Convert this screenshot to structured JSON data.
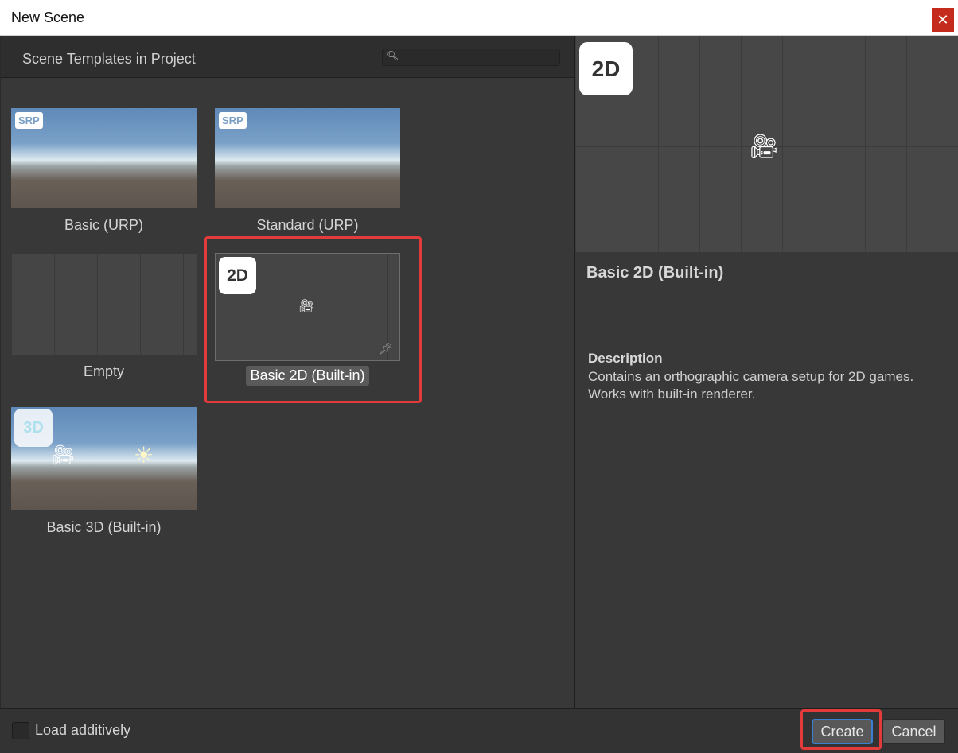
{
  "window": {
    "title": "New Scene",
    "close_glyph": "✕"
  },
  "left_panel": {
    "header": "Scene Templates in Project",
    "search_placeholder": "",
    "templates": [
      {
        "name": "Basic (URP)",
        "badge": "SRP",
        "thumb": "sky"
      },
      {
        "name": "Standard (URP)",
        "badge": "SRP",
        "thumb": "sky"
      },
      {
        "name": "Empty",
        "badge": "",
        "thumb": "dark"
      },
      {
        "name": "Basic 2D (Built-in)",
        "badge": "2D",
        "thumb": "dark",
        "selected": true,
        "pinned": true
      },
      {
        "name": "Basic 3D (Built-in)",
        "badge": "3D",
        "thumb": "sky"
      }
    ],
    "thumbnail_size_slider": 0.3
  },
  "right_panel": {
    "preview_badge": "2D",
    "title": "Basic 2D (Built-in)",
    "description_heading": "Description",
    "description": "Contains an orthographic camera setup for 2D games. Works with built-in renderer."
  },
  "footer": {
    "load_additively_label": "Load additively",
    "load_additively_checked": false,
    "create_label": "Create",
    "cancel_label": "Cancel"
  },
  "colors": {
    "highlight": "#e23b3b",
    "create_border": "#3c7fd2",
    "close_bg": "#c42b1c"
  },
  "icons": {
    "search": "search-icon",
    "camera": "camera-icon",
    "sun": "sun-icon",
    "pin": "pin-icon"
  }
}
